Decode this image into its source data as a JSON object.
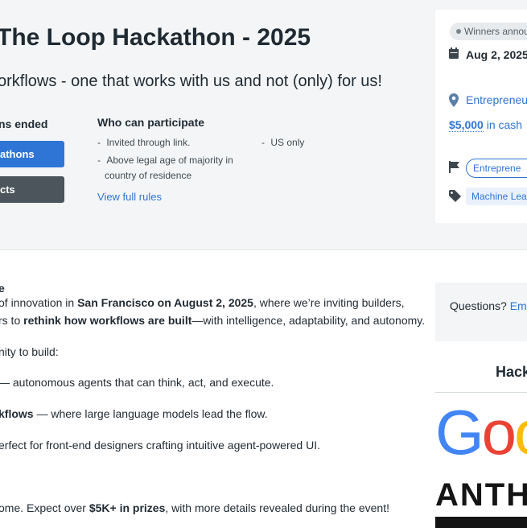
{
  "header": {
    "title": "The Loop Hackathon - 2025",
    "tagline": "orkflows - one that works with us and not (only) for us!",
    "status_text": "ns ended",
    "primary_button": "athons",
    "secondary_button": "cts",
    "who_heading": "Who can participate",
    "requirements_left": [
      "Invited through link.",
      "Above legal age of majority in",
      "country of residence"
    ],
    "requirements_right": [
      "US only"
    ],
    "rules_link": "View full rules"
  },
  "sidebar": {
    "status_pill": "Winners annou",
    "date": "Aug 2, 2025",
    "location": "Entrepreneu",
    "prize": "$5,000",
    "prize_suffix": "in cash",
    "theme_tag": "Entreprene",
    "tech_tag": "Machine Lea",
    "questions_label": "Questions?",
    "questions_link": "Ema",
    "sponsors_heading": "Hack",
    "google_letters": [
      "G",
      "o",
      "o"
    ],
    "anthropic_text": "ANTH"
  },
  "body": {
    "l1": "e",
    "l2a": "of innovation in ",
    "l2b": "San Francisco on August 2, 2025",
    "l2c": ", where we’re inviting builders,",
    "l3a": "rs to ",
    "l3b": "rethink how workflows are built",
    "l3c": "—with intelligence, adaptability, and autonomy.",
    "l4": "nity to build:",
    "l5": "— autonomous agents that can think, act, and execute.",
    "l6a": "kflows",
    "l6b": " — where large language models lead the flow.",
    "l7": "erfect for front-end designers crafting intuitive agent-powered UI.",
    "l8a": "ome. Expect over ",
    "l8b": "$5K+ in prizes",
    "l8c": ", with more details revealed during the event!"
  },
  "colors": {
    "accent": "#2f75d6",
    "dark_button": "#4b555b",
    "header_bg": "#f3f5f6"
  },
  "icons": [
    "calendar-icon",
    "location-pin-icon",
    "flag-icon",
    "tag-icon"
  ]
}
